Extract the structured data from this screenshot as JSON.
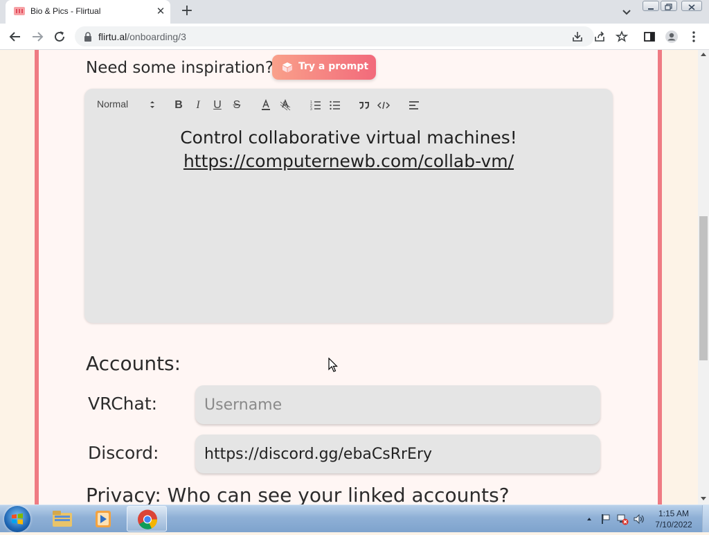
{
  "browser": {
    "tab_title": "Bio & Pics - Flirtual",
    "tab_close_glyph": "✕",
    "new_tab_glyph": "+",
    "url_host": "flirtu.al",
    "url_path": "/onboarding/3"
  },
  "page": {
    "inspiration_label": "Need some inspiration?",
    "prompt_button_label": "Try a prompt",
    "editor": {
      "format_select": "Normal",
      "content_line1": "Control collaborative virtual machines!",
      "content_link": "https://computernewb.com/collab-vm/",
      "toolbar_icons": [
        "bold-icon",
        "italic-icon",
        "underline-icon",
        "strike-icon",
        "text-color-icon",
        "background-color-icon",
        "ordered-list-icon",
        "bullet-list-icon",
        "blockquote-icon",
        "code-block-icon",
        "align-icon"
      ]
    },
    "accounts_title": "Accounts:",
    "accounts": [
      {
        "label": "VRChat:",
        "value": "",
        "placeholder": "Username"
      },
      {
        "label": "Discord:",
        "value": "https://discord.gg/ebaCsRrEry",
        "placeholder": ""
      }
    ],
    "privacy_title": "Privacy: Who can see your linked accounts?"
  },
  "colors": {
    "card_border": "#ef7b83",
    "prompt_gradient_start": "#f9a08a",
    "prompt_gradient_end": "#f26a7b",
    "editor_bg": "#e5e5e5"
  },
  "taskbar": {
    "apps": [
      "windows-explorer-icon",
      "media-player-icon",
      "chrome-icon"
    ],
    "time": "1:15 AM",
    "date": "7/10/2022"
  }
}
